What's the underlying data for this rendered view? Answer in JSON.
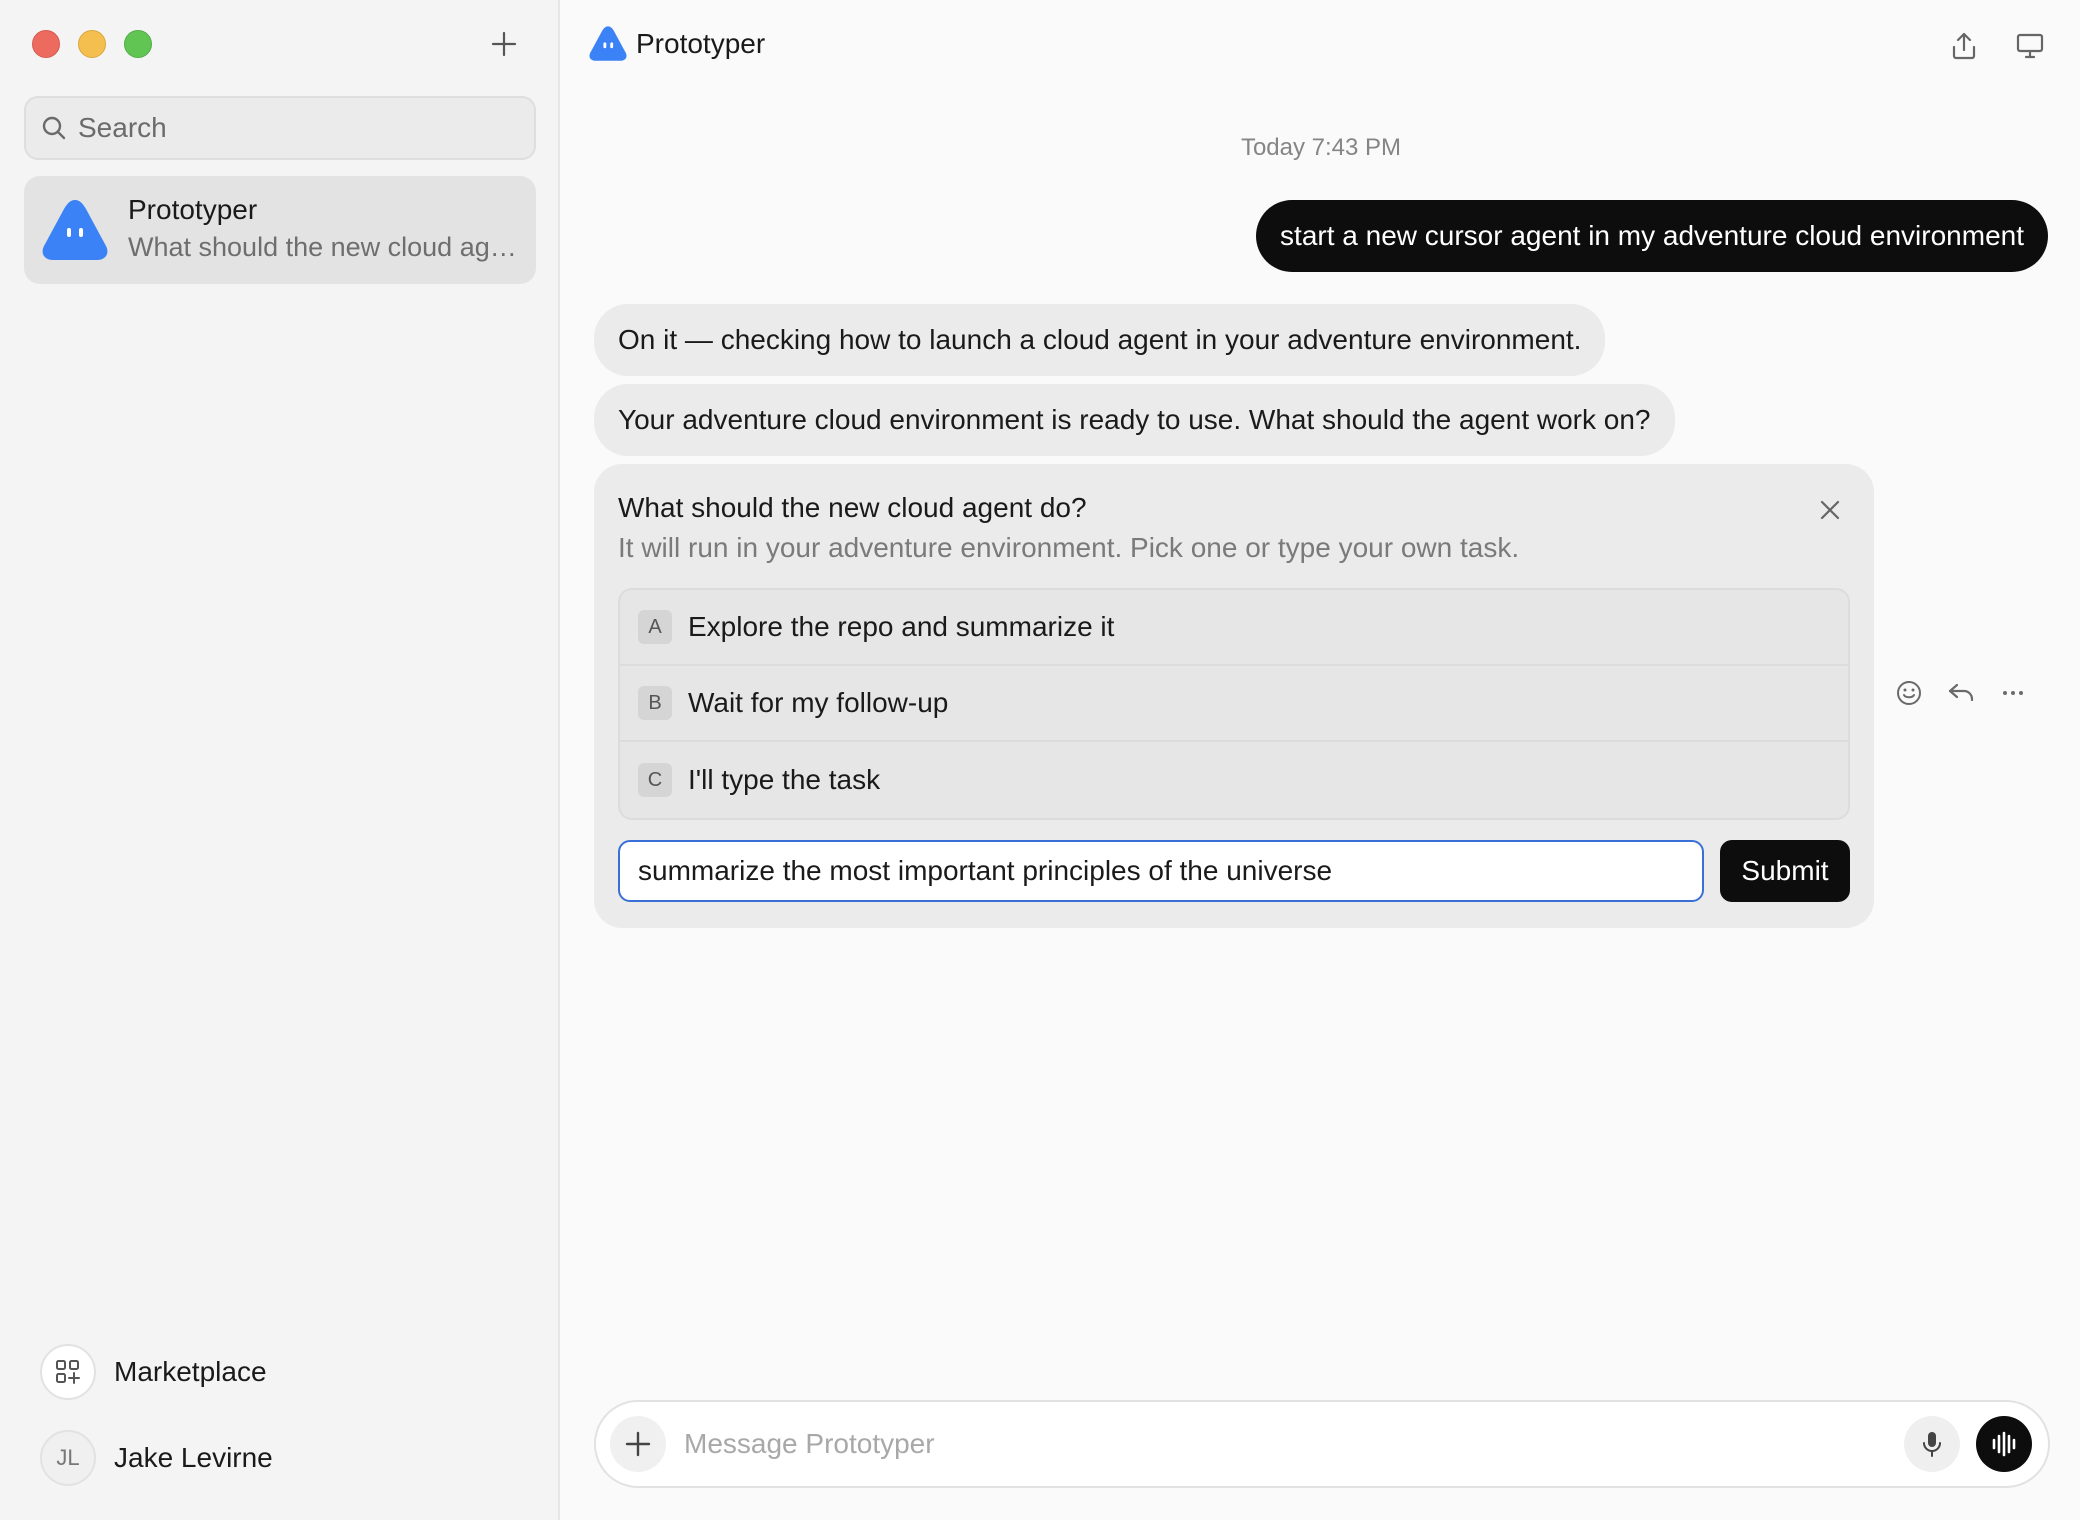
{
  "sidebar": {
    "search_placeholder": "Search",
    "conversation": {
      "title": "Prototyper",
      "preview": "What should the new cloud agent do?"
    },
    "marketplace_label": "Marketplace",
    "user": {
      "initials": "JL",
      "name": "Jake Levirne"
    }
  },
  "header": {
    "app_title": "Prototyper"
  },
  "chat": {
    "timestamp": "Today 7:43 PM",
    "user_message": "start a new cursor agent in my adventure cloud environment",
    "bot_messages": [
      "On it — checking how to launch a cloud agent in your adventure environment.",
      "Your adventure cloud environment is ready to use. What should the agent work on?"
    ],
    "question_card": {
      "title": "What should the new cloud agent do?",
      "subtitle": "It will run in your adventure environment. Pick one or type your own task.",
      "options": [
        {
          "key": "A",
          "label": "Explore the repo and summarize it"
        },
        {
          "key": "B",
          "label": "Wait for my follow-up"
        },
        {
          "key": "C",
          "label": "I'll type the task"
        }
      ],
      "input_value": "summarize the most important principles of the universe",
      "submit_label": "Submit"
    }
  },
  "composer": {
    "placeholder": "Message Prototyper"
  },
  "colors": {
    "accent_blue": "#3b82f6",
    "dark": "#0d0d0d"
  }
}
